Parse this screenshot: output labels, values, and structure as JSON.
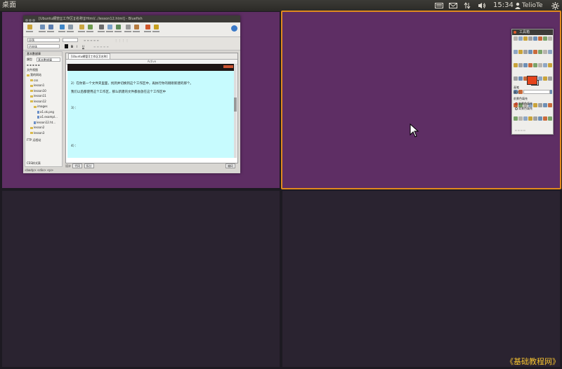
{
  "panel": {
    "title": "桌面",
    "clock": "15:34",
    "user": "TelioTe",
    "indicators": [
      "keyboard-icon",
      "mail-icon",
      "network-icon",
      "volume-icon",
      "user-icon",
      "gear-icon"
    ]
  },
  "dreamweaver": {
    "window_title": "[Ubuntu網管][工作区][名称][Html/../lesson12.html] - Bluefish",
    "doc_tab": "[Ubuntu網管][工作区][名称]",
    "ruler": "Active",
    "panel_header": "基本數據庫",
    "panel_sub": "類型",
    "panel_select": "基本數據庫",
    "file_view": "文件视图",
    "tree": [
      {
        "label": "我的网站",
        "type": "folder",
        "indent": 0
      },
      {
        "label": "css",
        "type": "folder",
        "indent": 1
      },
      {
        "label": "lesson1",
        "type": "folder",
        "indent": 1
      },
      {
        "label": "lesson10",
        "type": "folder",
        "indent": 1
      },
      {
        "label": "lesson11",
        "type": "folder",
        "indent": 1
      },
      {
        "label": "lesson12",
        "type": "folder",
        "indent": 1
      },
      {
        "label": "images",
        "type": "folder",
        "indent": 2
      },
      {
        "label": "a1.ok.png",
        "type": "file",
        "indent": 3
      },
      {
        "label": "a1.exampl...",
        "type": "file",
        "indent": 3
      },
      {
        "label": "lesson12.ht...",
        "type": "file",
        "indent": 2
      },
      {
        "label": "lesson2",
        "type": "folder",
        "indent": 1
      },
      {
        "label": "lesson3",
        "type": "folder",
        "indent": 1
      }
    ],
    "panel_footer": "FTP 远程站",
    "panel_footer2": "CSS样式表",
    "content_lines": [
      "2）在你第一个文件夹里面，找到并切换到这个工作区中，再执行你的刚刚新建的那个。",
      "我们以后都使用这个工作区，那么新建的文件都会放在这个工作区中",
      "3）：",
      "4）："
    ],
    "status_label": "设计",
    "status_tabs": [
      "代码",
      "拆分"
    ],
    "status_right": "编码",
    "tag_path": "<body> <div> <p>",
    "props": {
      "format": "段落",
      "font": "仿宋体",
      "color_label": "字体颜色"
    }
  },
  "toolbox": {
    "title": "工具箱",
    "option_label": "模式：",
    "option_title": "画笔",
    "radio_label": "前景色填充",
    "radios": [
      "前景色填充",
      "背景色填充"
    ]
  },
  "watermark": "《基础教程网》"
}
